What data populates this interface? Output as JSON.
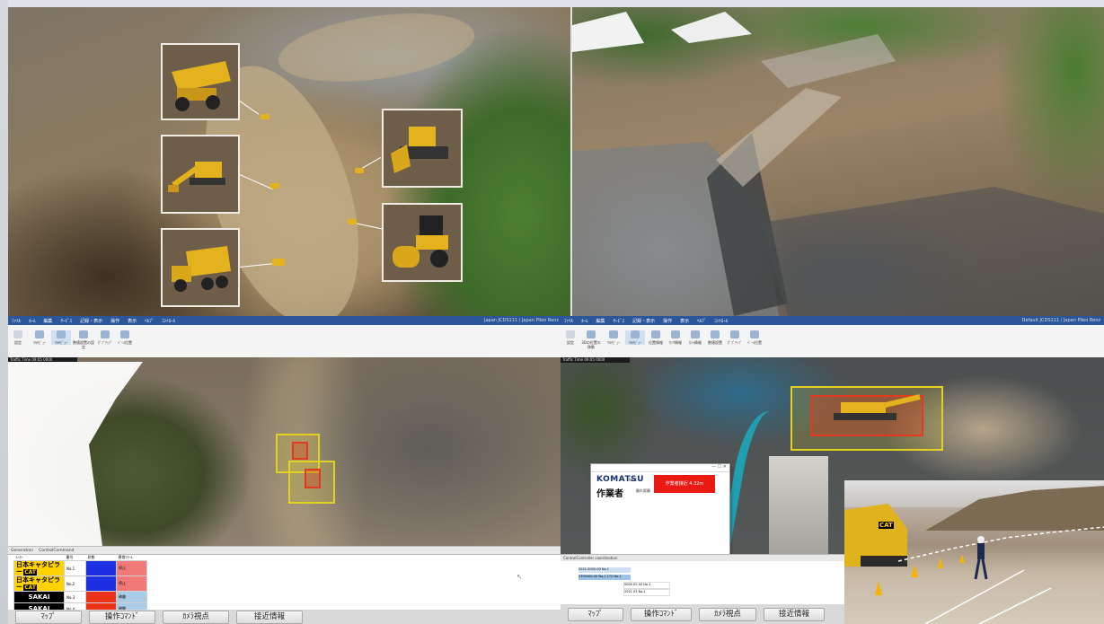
{
  "top_left": {
    "machines": [
      {
        "name": "dump-truck",
        "color": "#e3b21d"
      },
      {
        "name": "hydraulic-excavator",
        "color": "#e3b21d"
      },
      {
        "name": "articulated-dump-truck",
        "color": "#e3b21d"
      },
      {
        "name": "bulldozer",
        "color": "#e3b21d"
      },
      {
        "name": "road-roller",
        "color": "#e3b21d"
      }
    ]
  },
  "left_app": {
    "menu": [
      "ﾌｧｲﾙ",
      "ﾎｰﾑ",
      "編集",
      "ｻｰﾋﾞｽ",
      "記録・表示",
      "操作",
      "表示",
      "ﾍﾙﾌﾟ",
      "ｺﾝﾄﾛｰﾙ"
    ],
    "title_right": "Japan  JCDS111 / Japan Pileo Renz",
    "ribbon": [
      "設定",
      "ﾏﾙﾁﾋﾞｭｰ",
      "ﾏﾙﾁﾋﾞｭｰ",
      "数値設置の設定",
      "ﾎﾟﾌﾟｱｯﾌﾟ",
      "ﾍﾞｰｽ位置"
    ],
    "traffic": "Traffic Time   09:05 0000",
    "gen_tabs": [
      "Generation",
      "ControlCommand"
    ],
    "table_header": [
      "ﾒｰｶｰ",
      "番号",
      "状態",
      "異常ｱﾗｰﾑ"
    ],
    "rows": [
      {
        "maker": "日本キャタピラー",
        "brand": "CAT",
        "no": "No.1",
        "state_color": "#1d2fe0",
        "alarm": "停止",
        "alarm_color": "#f07a78"
      },
      {
        "maker": "日本キャタピラー",
        "brand": "CAT",
        "no": "No.2",
        "state_color": "#1d2fe0",
        "alarm": "停止",
        "alarm_color": "#f07a78"
      },
      {
        "maker": "SAKAI",
        "brand": "",
        "no": "No.3",
        "state_color": "#e8331a",
        "alarm": "稼働",
        "alarm_color": "#a9cde6"
      },
      {
        "maker": "SAKAI",
        "brand": "",
        "no": "No.4",
        "state_color": "#e8331a",
        "alarm": "稼働",
        "alarm_color": "#a9cde6"
      }
    ],
    "buttons": [
      "ﾏｯﾌﾟ",
      "操作ｺﾏﾝﾄﾞ",
      "ｶﾒﾗ視点",
      "接近情報"
    ]
  },
  "right_app": {
    "menu": [
      "ﾌｧｲﾙ",
      "ﾎｰﾑ",
      "編集",
      "ｻｰﾋﾞｽ",
      "記録・表示",
      "操作",
      "表示",
      "ﾍﾙﾌﾟ",
      "ｺﾝﾄﾛｰﾙ"
    ],
    "title_right": "Default   JCDS111 / Japan Pileo Renz",
    "ribbon": [
      "設定",
      "3Dの位置の移動",
      "ﾏﾙﾁﾋﾞｭｰ",
      "ﾏﾙﾁﾋﾞｭｰ",
      "位置情報",
      "ｾﾝｻ情報",
      "ｶﾒﾗ情報",
      "数値設置",
      "ﾎﾟﾌﾟｱｯﾌﾟ",
      "ﾍﾞｰｽ位置"
    ],
    "traffic": "Traffic Time   09:05 0000",
    "popup": {
      "brand": "KOMATSU",
      "label": "作業者",
      "no": "No.1",
      "distance_label": "離れ距離",
      "alarm": "作業者接近 4.32m",
      "alarm_color": "#ea1a12"
    },
    "control_title": "ControlController  coordination",
    "control_rows": [
      "2021-0000-00 No.1",
      "2300400-00 No.1 172 No.1",
      "0000 00 00 No.1",
      "2021 03 No.1"
    ],
    "buttons": [
      "ﾏｯﾌﾟ",
      "操作ｺﾏﾝﾄﾞ",
      "ｶﾒﾗ視点",
      "接近情報"
    ]
  },
  "camera": {
    "machine_brand": "CAT"
  }
}
